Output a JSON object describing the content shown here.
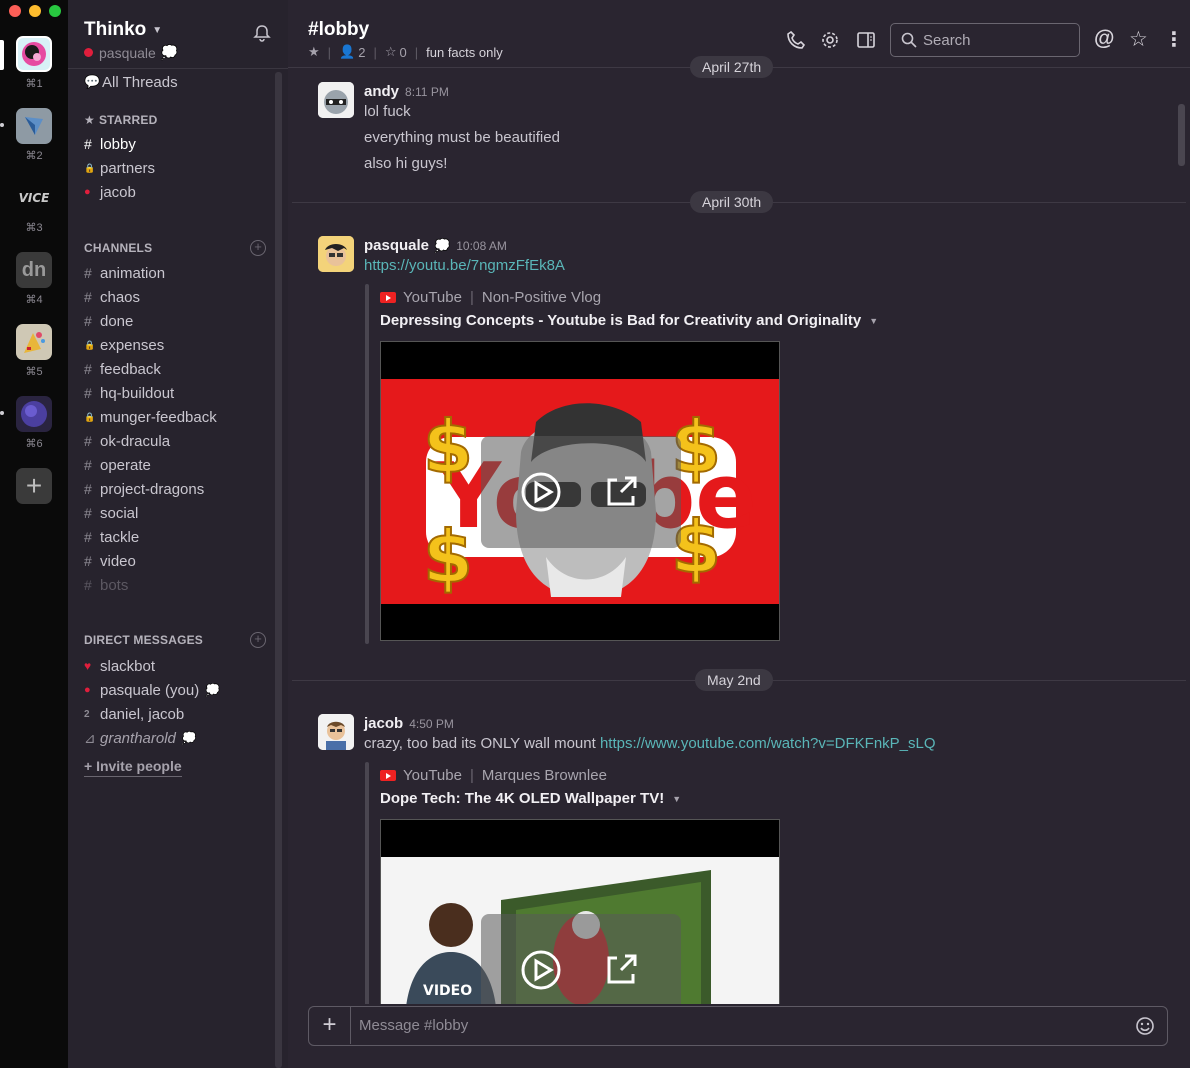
{
  "workspace": {
    "name": "Thinko",
    "user": "pasquale"
  },
  "teams": [
    {
      "key": "⌘1",
      "icon": "thinko-logo-icon"
    },
    {
      "key": "⌘2",
      "icon": "kite-logo-icon"
    },
    {
      "key": "⌘3",
      "icon": "vice-logo-icon",
      "text": "VICE"
    },
    {
      "key": "⌘4",
      "icon": "dn-logo-icon",
      "text": "dn"
    },
    {
      "key": "⌘5",
      "icon": "party-logo-icon"
    },
    {
      "key": "⌘6",
      "icon": "purple-orb-icon"
    }
  ],
  "sidebar": {
    "all_threads": "All Threads",
    "starred_heading": "STARRED",
    "starred": [
      {
        "glyph": "#",
        "label": "lobby"
      },
      {
        "glyph": "🔒",
        "label": "partners"
      },
      {
        "glyph": "●",
        "label": "jacob"
      }
    ],
    "channels_heading": "CHANNELS",
    "channels": [
      {
        "glyph": "#",
        "label": "animation"
      },
      {
        "glyph": "#",
        "label": "chaos"
      },
      {
        "glyph": "#",
        "label": "done"
      },
      {
        "glyph": "🔒",
        "label": "expenses"
      },
      {
        "glyph": "#",
        "label": "feedback"
      },
      {
        "glyph": "#",
        "label": "hq-buildout"
      },
      {
        "glyph": "🔒",
        "label": "munger-feedback"
      },
      {
        "glyph": "#",
        "label": "ok-dracula"
      },
      {
        "glyph": "#",
        "label": "operate"
      },
      {
        "glyph": "#",
        "label": "project-dragons"
      },
      {
        "glyph": "#",
        "label": "social"
      },
      {
        "glyph": "#",
        "label": "tackle"
      },
      {
        "glyph": "#",
        "label": "video"
      },
      {
        "glyph": "#",
        "label": "bots"
      }
    ],
    "dm_heading": "DIRECT MESSAGES",
    "dms": [
      {
        "glyph": "♥",
        "label": "slackbot"
      },
      {
        "glyph": "●",
        "label": "pasquale (you)"
      },
      {
        "glyph": "2",
        "label": "daniel, jacob"
      },
      {
        "glyph": "⊿",
        "label": "grantharold"
      }
    ],
    "invite": "+ Invite people"
  },
  "channel": {
    "title": "#lobby",
    "members": "2",
    "pins": "0",
    "topic": "fun facts only"
  },
  "search": {
    "placeholder": "Search"
  },
  "dates": [
    "April 27th",
    "April 30th",
    "May 2nd"
  ],
  "messages": [
    {
      "user": "andy",
      "time": "8:11 PM",
      "lines": [
        "lol fuck",
        "everything must be beautified",
        "also hi guys!"
      ]
    },
    {
      "user": "pasquale",
      "time": "10:08 AM",
      "link": "https://youtu.be/7ngmzFfEk8A",
      "attachment": {
        "source": "YouTube",
        "channel": "Non-Positive Vlog",
        "title": "Depressing Concepts - Youtube is Bad for Creativity and Originality"
      }
    },
    {
      "user": "jacob",
      "time": "4:50 PM",
      "text": "crazy, too bad its ONLY wall mount",
      "link": "https://www.youtube.com/watch?v=DFKFnkP_sLQ",
      "attachment": {
        "source": "YouTube",
        "channel": "Marques Brownlee",
        "title": "Dope Tech: The 4K OLED Wallpaper TV!"
      }
    }
  ],
  "composer": {
    "placeholder": "Message #lobby"
  },
  "colors": {
    "rail": "#0a0a0a",
    "sidebar": "#27232d",
    "main": "#2a2530",
    "link": "#5ab6b8",
    "presence": "#e01e3c"
  }
}
